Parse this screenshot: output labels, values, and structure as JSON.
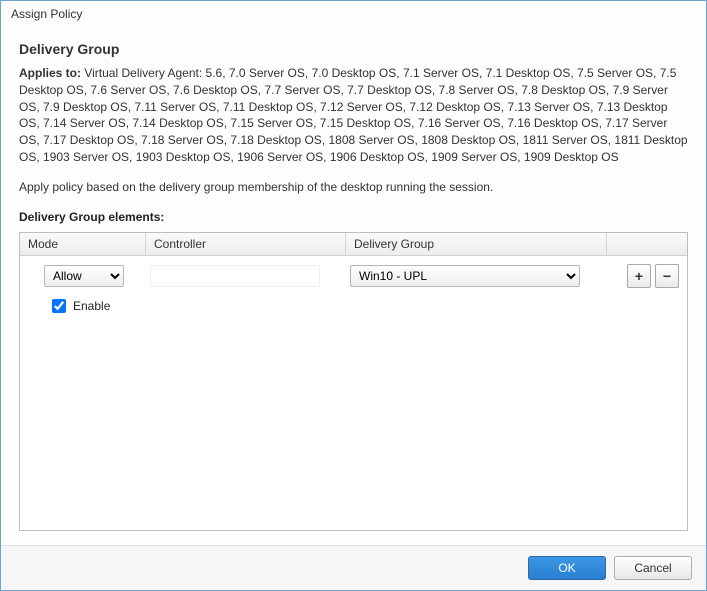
{
  "dialogTitle": "Assign Policy",
  "sectionHeading": "Delivery Group",
  "appliesToLabel": "Applies to:",
  "appliesToText": "Virtual Delivery Agent: 5.6, 7.0 Server OS, 7.0 Desktop OS, 7.1 Server OS, 7.1 Desktop OS, 7.5 Server OS, 7.5 Desktop OS, 7.6 Server OS, 7.6 Desktop OS, 7.7 Server OS, 7.7 Desktop OS, 7.8 Server OS, 7.8 Desktop OS, 7.9 Server OS, 7.9 Desktop OS, 7.11 Server OS, 7.11 Desktop OS, 7.12 Server OS, 7.12 Desktop OS, 7.13 Server OS, 7.13 Desktop OS, 7.14 Server OS, 7.14 Desktop OS, 7.15 Server OS, 7.15 Desktop OS, 7.16 Server OS, 7.16 Desktop OS, 7.17 Server OS, 7.17 Desktop OS, 7.18 Server OS, 7.18 Desktop OS, 1808 Server OS, 1808 Desktop OS, 1811 Server OS, 1811 Desktop OS, 1903 Server OS, 1903 Desktop OS, 1906 Server OS, 1906 Desktop OS, 1909 Server OS, 1909 Desktop OS",
  "description": "Apply policy based on the delivery group membership of the desktop running the session.",
  "elementsLabel": "Delivery Group elements:",
  "columns": {
    "mode": "Mode",
    "controller": "Controller",
    "deliveryGroup": "Delivery Group"
  },
  "rows": [
    {
      "mode": "Allow",
      "controller": "",
      "deliveryGroup": "Win10 - UPL",
      "enable": true
    }
  ],
  "enableLabel": "Enable",
  "icons": {
    "plus": "+",
    "minus": "−"
  },
  "buttons": {
    "ok": "OK",
    "cancel": "Cancel"
  }
}
